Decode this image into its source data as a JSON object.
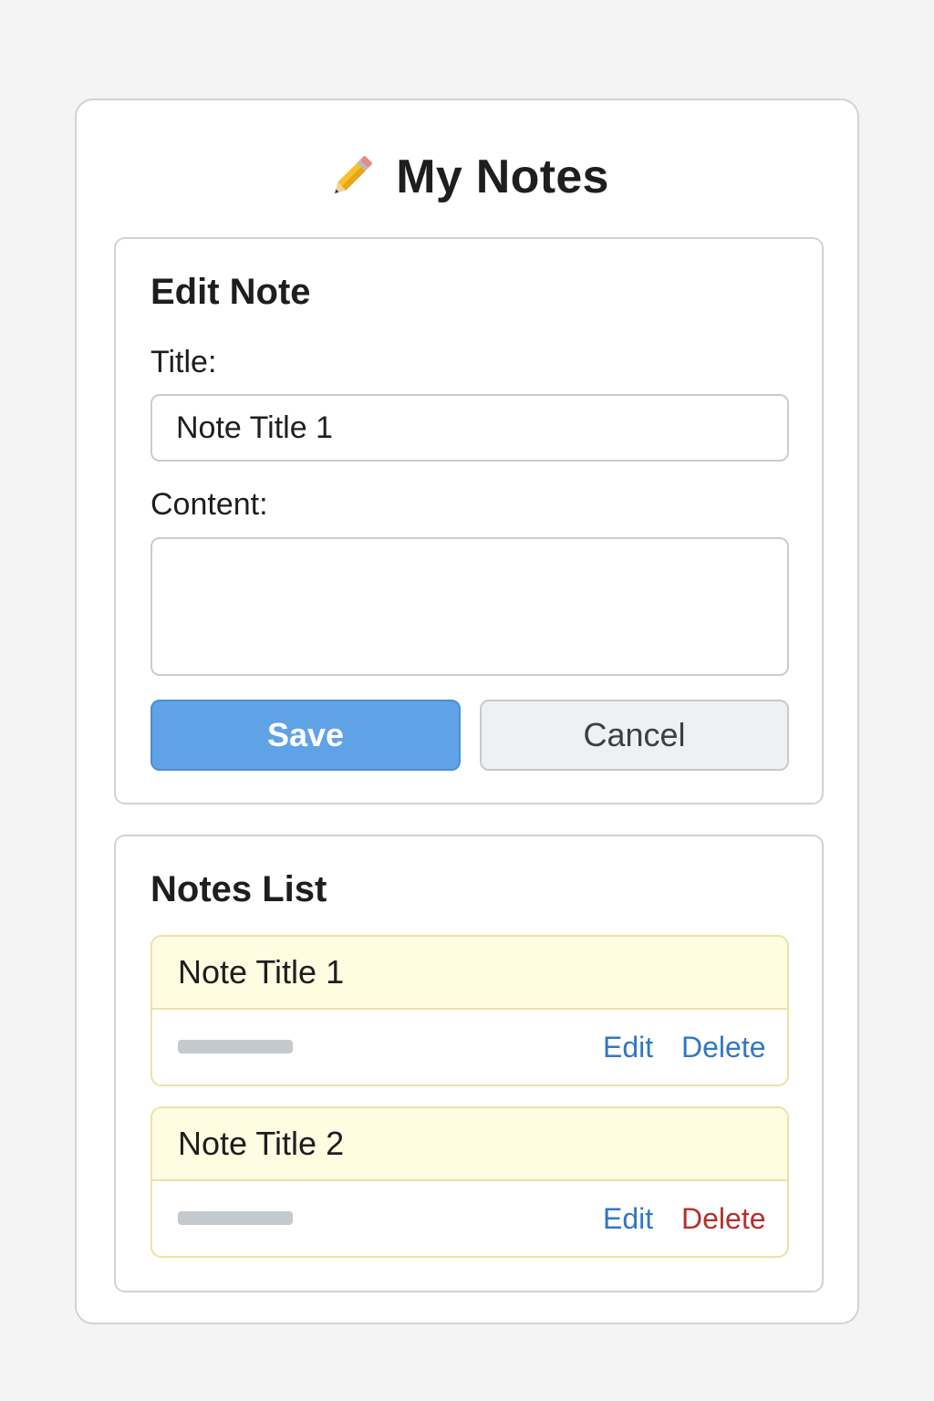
{
  "app": {
    "title": "My Notes",
    "icon": "pencil-icon"
  },
  "edit_form": {
    "heading": "Edit Note",
    "title_label": "Title:",
    "title_value": "Note Title 1",
    "content_label": "Content:",
    "content_value": "",
    "save_label": "Save",
    "cancel_label": "Cancel"
  },
  "notes_list": {
    "heading": "Notes List",
    "items": [
      {
        "title": "Note Title 1",
        "edit_label": "Edit",
        "delete_label": "Delete",
        "delete_color": "#2f78c4"
      },
      {
        "title": "Note Title 2",
        "edit_label": "Edit",
        "delete_label": "Delete",
        "delete_color": "#b3312b"
      }
    ]
  },
  "colors": {
    "accent": "#5fa2e6",
    "link": "#2f78c4",
    "danger": "#b3312b",
    "note_header_bg": "#fefde2",
    "note_border": "#ece2a6"
  }
}
